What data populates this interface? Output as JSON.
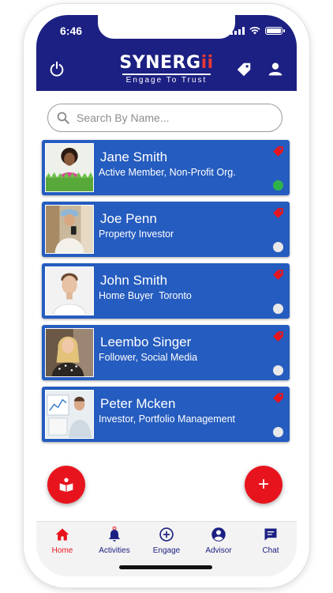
{
  "status_bar": {
    "time": "6:46"
  },
  "app_bar": {
    "logo_main": "SYNERG",
    "logo_accent": "ii",
    "logo_tagline": "Engage To Trust"
  },
  "search": {
    "placeholder": "Search By Name..."
  },
  "contacts": [
    {
      "name": "Jane Smith",
      "role": "Active Member, Non-Profit Org.",
      "status": "online"
    },
    {
      "name": "Joe Penn",
      "role": "Property Investor",
      "status": "offline"
    },
    {
      "name": "John Smith",
      "role": "Home Buyer  Toronto",
      "status": "offline"
    },
    {
      "name": "Leembo Singer",
      "role": "Follower, Social Media",
      "status": "offline"
    },
    {
      "name": "Peter Mcken",
      "role": "Investor, Portfolio Management",
      "status": "offline"
    }
  ],
  "fab_add": {
    "label": "+"
  },
  "bottom_nav": [
    {
      "label": "Home",
      "icon": "home-icon",
      "active": true
    },
    {
      "label": "Activities",
      "icon": "bell-icon",
      "active": false
    },
    {
      "label": "Engage",
      "icon": "plus-circle-icon",
      "active": false
    },
    {
      "label": "Advisor",
      "icon": "person-circle-icon",
      "active": false
    },
    {
      "label": "Chat",
      "icon": "chat-icon",
      "active": false
    }
  ],
  "colors": {
    "primary": "#1c2082",
    "card": "#255cbf",
    "accent": "#e8141d",
    "online": "#2fb44c"
  }
}
